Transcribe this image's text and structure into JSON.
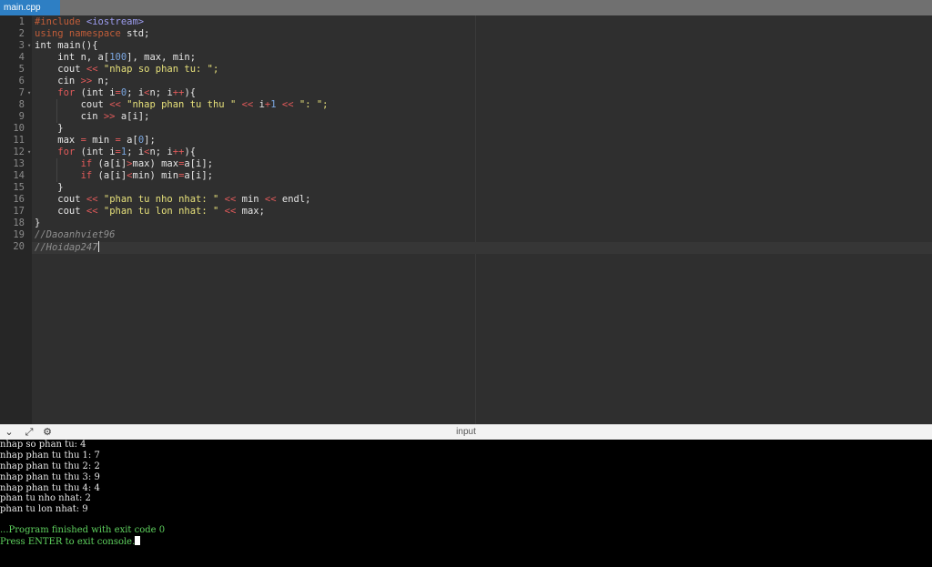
{
  "tab": {
    "filename": "main.cpp"
  },
  "editor": {
    "line_numbers": [
      "1",
      "2",
      "3",
      "4",
      "5",
      "6",
      "7",
      "8",
      "9",
      "10",
      "11",
      "12",
      "13",
      "14",
      "15",
      "16",
      "17",
      "18",
      "19",
      "20"
    ],
    "fold_markers": [
      "▾",
      "▾",
      "▾"
    ]
  },
  "io": {
    "title": "input",
    "icons": [
      "chevron-down-icon",
      "expand-icon",
      "settings-icon"
    ],
    "output": [
      "nhap so phan tu: 4",
      "nhap phan tu thu 1: 7",
      "nhap phan tu thu 2: 2",
      "nhap phan tu thu 3: 9",
      "nhap phan tu thu 4: 4",
      "phan tu nho nhat: 2",
      "phan tu lon nhat: 9"
    ],
    "finish_message": "...Program finished with exit code 0",
    "exit_prompt": "Press ENTER to exit console."
  },
  "code": {
    "l1a": "#include ",
    "l1b": "<iostream>",
    "l2a": "using namespace",
    "l2b": " std;",
    "l3": "int main(){",
    "l4a": "    int n, a[",
    "l4b": "100",
    "l4c": "], max, min;",
    "l5a": "    cout ",
    "l5b": "<<",
    "l5c": " \"nhap so phan tu: \";",
    "l6a": "    cin ",
    "l6b": ">>",
    "l6c": " n;",
    "l7a": "    ",
    "l7b": "for",
    "l7c": " (int i",
    "l7d": "=",
    "l7e": "0",
    "l7f": "; i",
    "l7g": "<",
    "l7h": "n; i",
    "l7i": "++",
    "l7j": "){",
    "l8a": "        cout ",
    "l8b": "<<",
    "l8c": " \"nhap phan tu thu \" ",
    "l8d": "<<",
    "l8e": " i",
    "l8f": "+",
    "l8g": "1",
    "l8h": " ",
    "l8i": "<<",
    "l8j": " \": \";",
    "l9a": "        cin ",
    "l9b": ">>",
    "l9c": " a[i];",
    "l10": "    }",
    "l11a": "    max ",
    "l11b": "=",
    "l11c": " min ",
    "l11d": "=",
    "l11e": " a[",
    "l11f": "0",
    "l11g": "];",
    "l12a": "    ",
    "l12b": "for",
    "l12c": " (int i",
    "l12d": "=",
    "l12e": "1",
    "l12f": "; i",
    "l12g": "<",
    "l12h": "n; i",
    "l12i": "++",
    "l12j": "){",
    "l13a": "        ",
    "l13b": "if",
    "l13c": " (a[i]",
    "l13d": ">",
    "l13e": "max) max",
    "l13f": "=",
    "l13g": "a[i];",
    "l14a": "        ",
    "l14b": "if",
    "l14c": " (a[i]",
    "l14d": "<",
    "l14e": "min) min",
    "l14f": "=",
    "l14g": "a[i];",
    "l15": "    }",
    "l16a": "    cout ",
    "l16b": "<<",
    "l16c": " \"phan tu nho nhat: \" ",
    "l16d": "<<",
    "l16e": " min ",
    "l16f": "<<",
    "l16g": " endl;",
    "l17a": "    cout ",
    "l17b": "<<",
    "l17c": " \"phan tu lon nhat: \" ",
    "l17d": "<<",
    "l17e": " max;",
    "l18": "}",
    "l19": "//Daoanhviet96",
    "l20": "//Hoidap247"
  }
}
